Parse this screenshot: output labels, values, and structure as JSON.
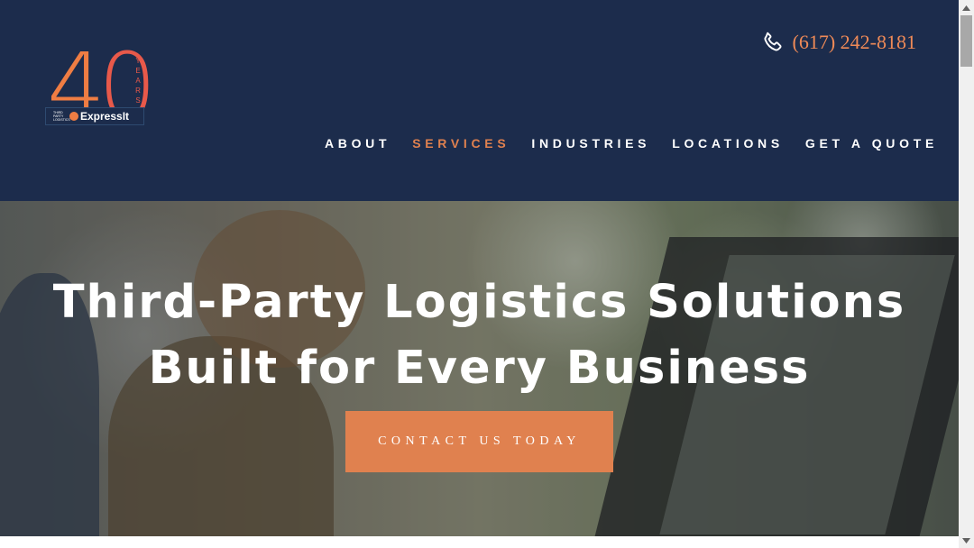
{
  "colors": {
    "header_bg": "#1c2c4c",
    "accent": "#e0814f",
    "phone_text": "#ef8a57",
    "logo_red": "#e8594a",
    "logo_orange": "#ef7d43"
  },
  "logo": {
    "digits": "40",
    "years": "YEARS",
    "tagline": "THIRD PARTY LOGISTICS",
    "brand": "ExpressIt",
    "icon": "expressit-mark-icon"
  },
  "phone": {
    "icon": "phone-icon",
    "number": "(617) 242-8181"
  },
  "nav": {
    "items": [
      {
        "label": "ABOUT",
        "active": false
      },
      {
        "label": "SERVICES",
        "active": true
      },
      {
        "label": "INDUSTRIES",
        "active": false
      },
      {
        "label": "LOCATIONS",
        "active": false
      },
      {
        "label": "GET A QUOTE",
        "active": false
      }
    ]
  },
  "hero": {
    "title_line1": "Third-Party Logistics Solutions",
    "title_line2": "Built for Every Business",
    "cta_label": "CONTACT US TODAY"
  },
  "scrollbar": {
    "up_icon": "scroll-up-arrow-icon",
    "down_icon": "scroll-down-arrow-icon"
  }
}
